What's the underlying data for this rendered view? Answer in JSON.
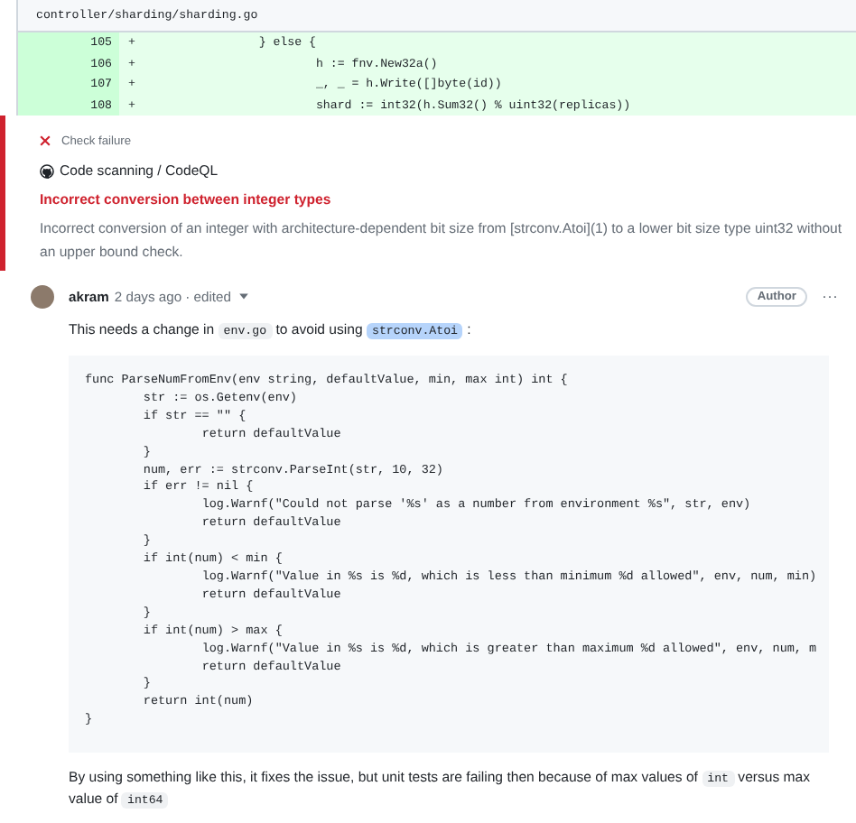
{
  "file": {
    "path": "controller/sharding/sharding.go",
    "lines": [
      {
        "number": "105",
        "sign": "+",
        "code": "\t\t} else {"
      },
      {
        "number": "106",
        "sign": "+",
        "code": "\t\t\th := fnv.New32a()"
      },
      {
        "number": "107",
        "sign": "+",
        "code": "\t\t\t_, _ = h.Write([]byte(id))"
      },
      {
        "number": "108",
        "sign": "+",
        "code": "\t\t\tshard := int32(h.Sum32() % uint32(replicas))"
      }
    ]
  },
  "check": {
    "status": "Check failure",
    "source": "Code scanning / CodeQL",
    "title": "Incorrect conversion between integer types",
    "description": "Incorrect conversion of an integer with architecture-dependent bit size from [strconv.Atoi](1) to a lower bit size type uint32 without an upper bound check."
  },
  "comment": {
    "author": "akram",
    "meta": "2 days ago · edited",
    "badge": "Author",
    "more": "···",
    "body": [
      {
        "kind": "text",
        "text": "This needs a change in ",
        "highlighted": false
      },
      {
        "kind": "code",
        "text": "env.go",
        "highlighted": false
      },
      {
        "kind": "text",
        "text": " to avoid using ",
        "highlighted": false
      },
      {
        "kind": "code",
        "text": "strconv.Atoi",
        "highlighted": true
      },
      {
        "kind": "text",
        "text": " :",
        "highlighted": false
      }
    ],
    "code": [
      "func ParseNumFromEnv(env string, defaultValue, min, max int) int {",
      "\tstr := os.Getenv(env)",
      "\tif str == \"\" {",
      "\t\treturn defaultValue",
      "\t}",
      "\tnum, err := strconv.ParseInt(str, 10, 32)",
      "\tif err != nil {",
      "\t\tlog.Warnf(\"Could not parse '%s' as a number from environment %s\", str, env)",
      "\t\treturn defaultValue",
      "\t}",
      "\tif int(num) < min {",
      "\t\tlog.Warnf(\"Value in %s is %d, which is less than minimum %d allowed\", env, num, min)",
      "\t\treturn defaultValue",
      "\t}",
      "\tif int(num) > max {",
      "\t\tlog.Warnf(\"Value in %s is %d, which is greater than maximum %d allowed\", env, num, m",
      "\t\treturn defaultValue",
      "\t}",
      "\treturn int(num)",
      "}"
    ],
    "footer": [
      {
        "kind": "text",
        "text": "By using something like this, it fixes the issue, but unit tests are failing then because of max values of ",
        "highlighted": false
      },
      {
        "kind": "code",
        "text": "int",
        "highlighted": false
      },
      {
        "kind": "text",
        "text": " versus max value of ",
        "highlighted": false
      },
      {
        "kind": "code",
        "text": "int64",
        "highlighted": false
      }
    ]
  }
}
